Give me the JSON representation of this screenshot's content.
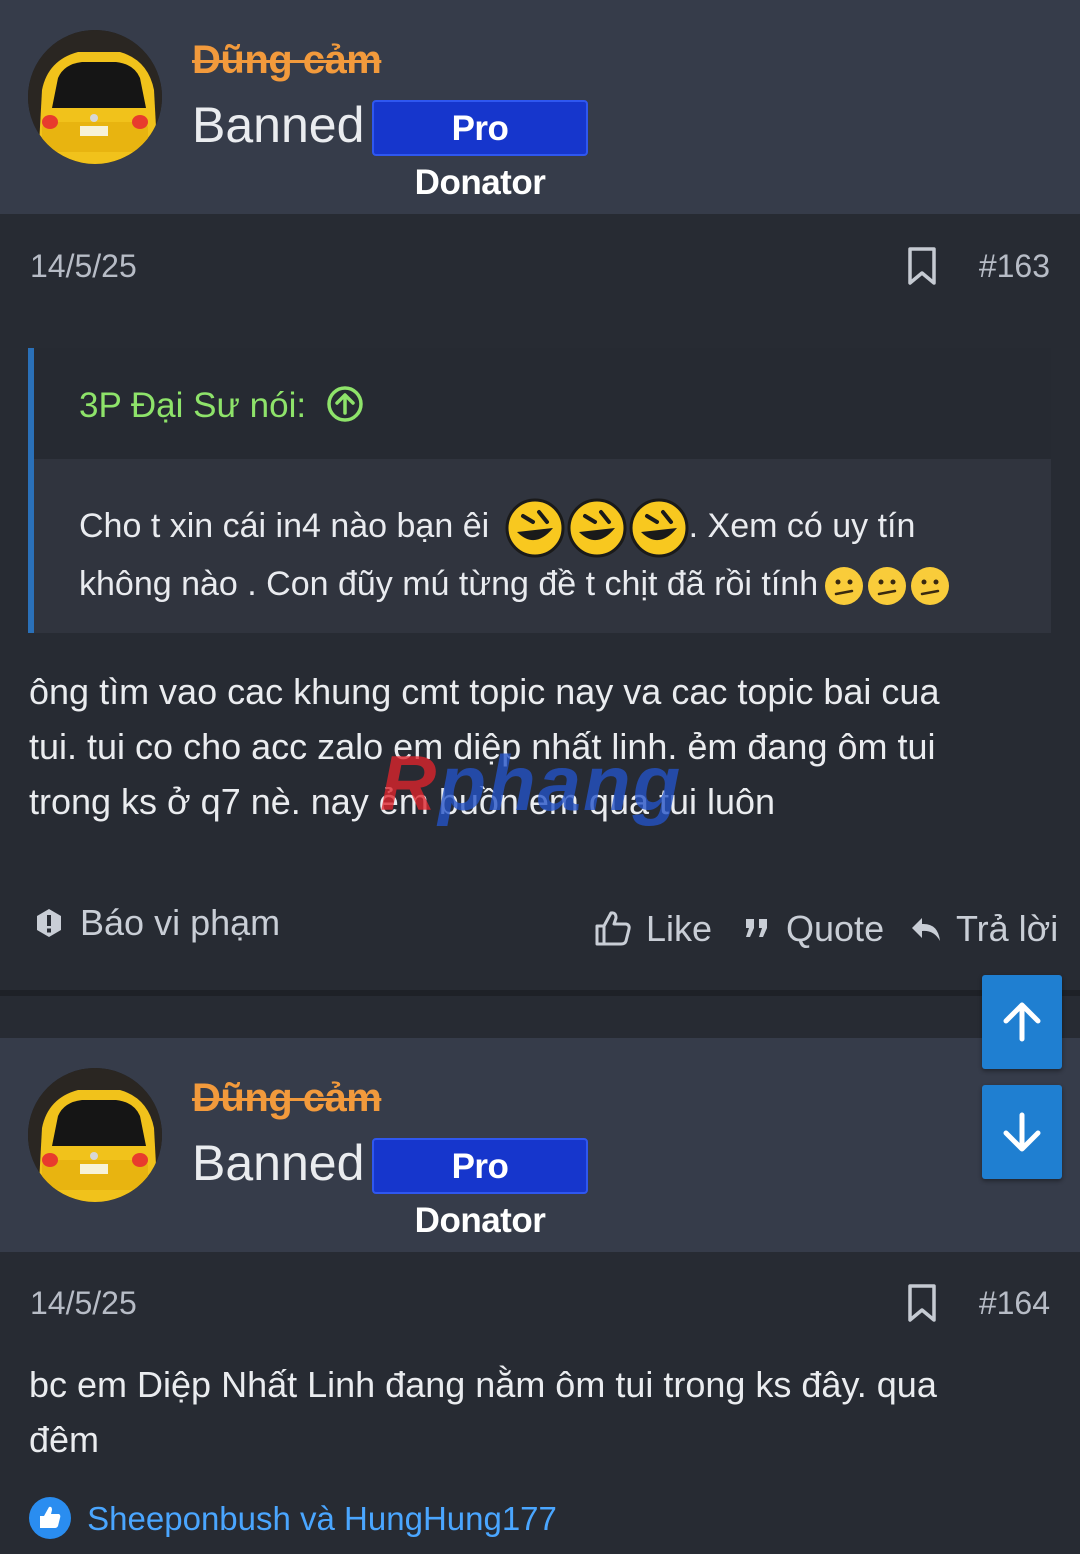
{
  "posts": [
    {
      "username": "Dũng cảm",
      "status": "Banned",
      "badge": "Pro Donator",
      "date": "14/5/25",
      "number": "#163",
      "quote": {
        "author": "3P Đại Sư nói:",
        "line1_a": "Cho t xin cái in4 nào bạn êi",
        "line1_b": ". Xem có uy tín",
        "line2": "không nào . Con đũy mú từng đề t chịt đã rồi tính"
      },
      "body_lines": [
        "ông tìm vao cac khung cmt topic nay va cac topic bai cua",
        "tui. tui co cho acc zalo em diệp nhất linh. ẻm đang ôm tui",
        "trong ks ở q7 nè. nay ẻm buồn em qua tui luôn"
      ],
      "actions": {
        "report": "Báo vi phạm",
        "like": "Like",
        "quote": "Quote",
        "reply": "Trả lời"
      }
    },
    {
      "username": "Dũng cảm",
      "status": "Banned",
      "badge": "Pro Donator",
      "date": "14/5/25",
      "number": "#164",
      "body_lines": [
        "bc em Diệp Nhất Linh đang nằm ôm tui trong ks đây. qua",
        "đêm"
      ],
      "reactions": "Sheeponbush và HungHung177"
    }
  ],
  "watermark": "Rphang",
  "icons": {
    "bookmark": "bookmark-icon",
    "up": "arrow-up-icon",
    "down": "arrow-down-icon",
    "like": "thumbs-up-icon",
    "quote": "quote-icon",
    "reply": "reply-icon",
    "report": "alert-icon",
    "quote_up": "circle-arrow-up-icon"
  },
  "colors": {
    "username": "#f29a3c",
    "badge": "#1636cc",
    "quote_author": "#8ee36a",
    "link": "#4aa6ff",
    "scroll_button": "#1f7fd1"
  }
}
